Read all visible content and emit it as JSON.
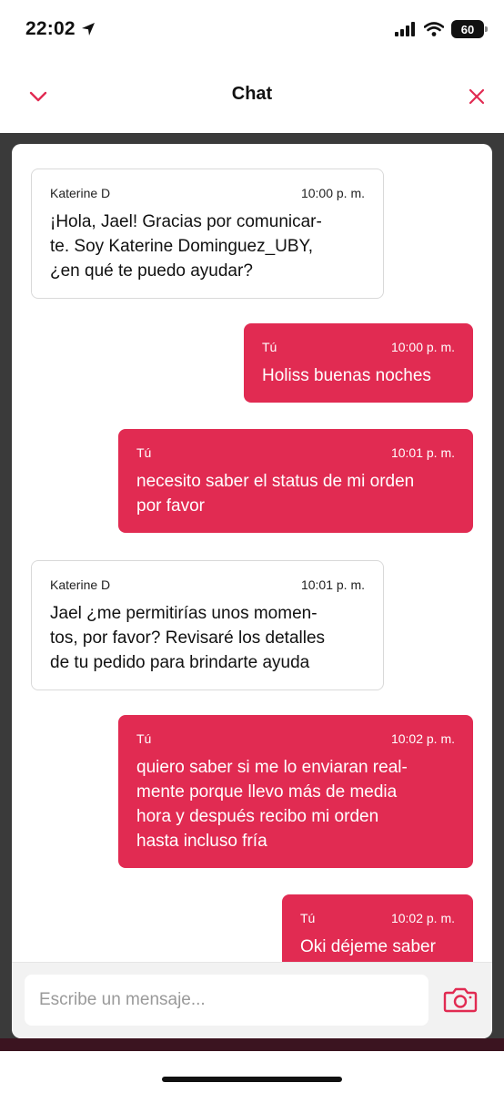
{
  "status_bar": {
    "time": "22:02",
    "battery": "60"
  },
  "header": {
    "title": "Chat"
  },
  "colors": {
    "accent": "#e12b52",
    "backdrop": "#3a3a3a"
  },
  "messages": [
    {
      "direction": "in",
      "sender": "Katerine D",
      "time": "10:00 p. m.",
      "text": "¡Hola, Jael! Gracias por comunicar-\nte. Soy Katerine Dominguez_UBY,\n¿en qué te puedo ayudar?"
    },
    {
      "direction": "out",
      "sender": "Tú",
      "time": "10:00 p. m.",
      "text": "Holiss buenas noches"
    },
    {
      "direction": "out",
      "sender": "Tú",
      "time": "10:01 p. m.",
      "text": "necesito saber el status de mi orden\npor favor"
    },
    {
      "direction": "in",
      "sender": "Katerine D",
      "time": "10:01 p. m.",
      "text": "Jael ¿me permitirías unos momen-\ntos, por favor? Revisaré los detalles\nde tu pedido para brindarte ayuda"
    },
    {
      "direction": "out",
      "sender": "Tú",
      "time": "10:02 p. m.",
      "text": "quiero saber si me lo enviaran real-\nmente porque llevo más de media\nhora y después recibo mi orden\nhasta incluso fría"
    },
    {
      "direction": "out",
      "sender": "Tú",
      "time": "10:02 p. m.",
      "text": "Oki déjeme saber"
    }
  ],
  "composer": {
    "placeholder": "Escribe un mensaje...",
    "camera_icon": "camera-icon"
  }
}
